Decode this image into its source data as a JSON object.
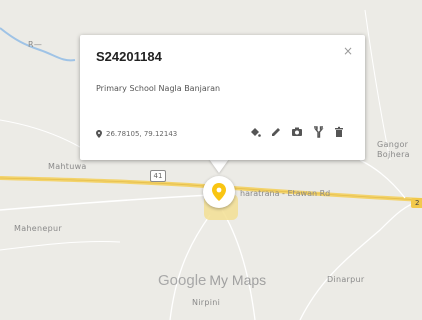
{
  "popup": {
    "title": "S24201184",
    "description": "Primary School Nagla Banjaran",
    "coordinates": "26.78105, 79.12143",
    "close_symbol": "×",
    "tools": [
      {
        "name": "style-icon"
      },
      {
        "name": "edit-icon"
      },
      {
        "name": "camera-icon"
      },
      {
        "name": "directions-icon"
      },
      {
        "name": "delete-icon"
      }
    ]
  },
  "map": {
    "places": {
      "mahtuwa": "Mahtuwa",
      "mahenepur": "Mahenepur",
      "gangor": "Gangor",
      "bojhera": "Bojhera",
      "dinarpur": "Dinarpur",
      "nirpini": "Nirpini",
      "river": "R—"
    },
    "road_label": "haratrana - Etawan Rd",
    "highway_shield": "41",
    "edge_shield": "2",
    "marker_color": "#f9c513",
    "water_color": "#9fc3e6"
  },
  "watermark": {
    "google": "Google",
    "product": "My Maps"
  }
}
